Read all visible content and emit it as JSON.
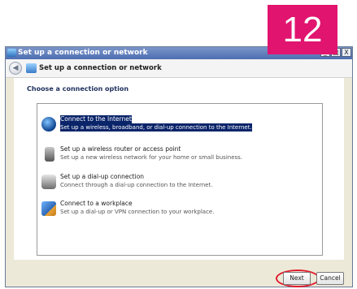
{
  "step_badge": {
    "number": "12",
    "color": "#e1146f"
  },
  "window": {
    "title": "Set up a connection or network",
    "controls": {
      "minimize": "_",
      "maximize": "□",
      "close": "X"
    }
  },
  "nav": {
    "back_icon": "back-arrow-icon",
    "title": "Set up a connection or network"
  },
  "main": {
    "heading": "Choose a connection option",
    "options": [
      {
        "title": "Connect to the Internet",
        "desc": "Set up a wireless, broadband, or dial-up connection to the Internet.",
        "icon": "globe-icon",
        "selected": true
      },
      {
        "title": "Set up a wireless router or access point",
        "desc": "Set up a new wireless network for your home or small business.",
        "icon": "router-icon"
      },
      {
        "title": "Set up a dial-up connection",
        "desc": "Connect through a dial-up connection to the Internet.",
        "icon": "phone-icon"
      },
      {
        "title": "Connect to a workplace",
        "desc": "Set up a dial-up or VPN connection to your workplace.",
        "icon": "workplace-icon"
      }
    ]
  },
  "footer": {
    "next_label": "Next",
    "cancel_label": "Cancel",
    "highlight_color": "#e11c2f"
  },
  "colors": {
    "selection": "#0a246a",
    "titlebar": "#4d6eb2"
  }
}
